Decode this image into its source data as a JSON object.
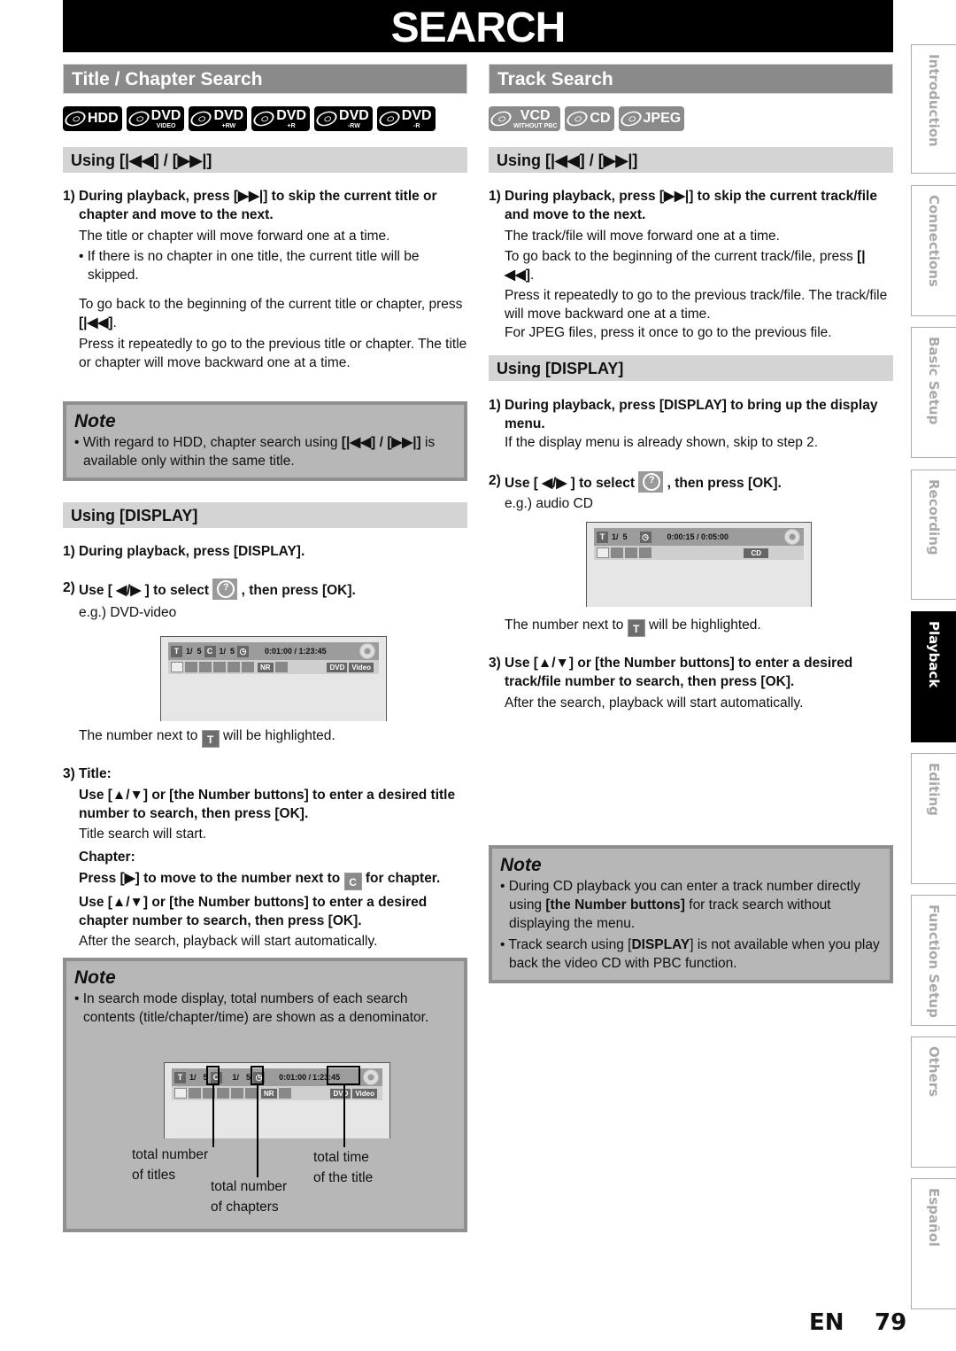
{
  "page": {
    "title": "SEARCH",
    "language": "EN",
    "page_number": "79"
  },
  "side_tabs": [
    {
      "label": "Introduction",
      "active": false
    },
    {
      "label": "Connections",
      "active": false
    },
    {
      "label": "Basic Setup",
      "active": false
    },
    {
      "label": "Recording",
      "active": false
    },
    {
      "label": "Playback",
      "active": true
    },
    {
      "label": "Editing",
      "active": false
    },
    {
      "label": "Function Setup",
      "active": false
    },
    {
      "label": "Others",
      "active": false
    },
    {
      "label": "Español",
      "active": false
    }
  ],
  "left": {
    "heading": "Title / Chapter Search",
    "media": [
      {
        "main": "HDD",
        "sub": ""
      },
      {
        "main": "DVD",
        "sub": "VIDEO"
      },
      {
        "main": "DVD",
        "sub": "+RW"
      },
      {
        "main": "DVD",
        "sub": "+R"
      },
      {
        "main": "DVD",
        "sub": "-RW"
      },
      {
        "main": "DVD",
        "sub": "-R"
      }
    ],
    "skip": {
      "heading": "Using [|◀◀] / [▶▶|]",
      "step1_num": "1)",
      "step1_bold": "During playback, press [▶▶|] to skip the current title or chapter and move to the next.",
      "step1_text": "The title or chapter will move forward one at a time.",
      "step1_bullet": "• If there is no chapter in one title, the current title will be skipped.",
      "back_text_a": "To go back to the beginning of the current title or chapter, press ",
      "back_key": "[|◀◀]",
      "back_text_b": ".",
      "repeat_text": "Press it repeatedly to go to the previous title or chapter. The title or chapter will move backward one at a time."
    },
    "note1": {
      "title": "Note",
      "item_a": "• With regard to HDD, chapter search using ",
      "item_key": "[|◀◀] / [▶▶|]",
      "item_b": " is available only within the same title."
    },
    "display": {
      "heading": "Using [DISPLAY]",
      "step1_num": "1)",
      "step1_bold": "During playback, press [DISPLAY].",
      "step2_num": "2)",
      "step2_bold_a": "Use [ ◀/▶ ] to select ",
      "step2_bold_b": " , then press [OK].",
      "example": "e.g.) DVD-video",
      "osd": {
        "title_icon": "T",
        "title_pos": "1/  5",
        "chapter_icon": "C",
        "chapter_pos": "1/  5",
        "time": "0:01:00 / 1:23:45",
        "tag1": "DVD",
        "tag2": "Video",
        "nr": "NR"
      },
      "highlight_a": "The number next to ",
      "highlight_icon": "T",
      "highlight_b": " will be highlighted.",
      "step3_num": "3)",
      "title_label": "Title:",
      "title_instr": "Use [▲/▼] or [the Number buttons] to enter a desired title number to search, then press [OK].",
      "title_result": "Title search will start.",
      "chapter_label": "Chapter:",
      "chapter_move_a": "Press [▶] to move to the number next to ",
      "chapter_icon": "C",
      "chapter_move_b": " for chapter.",
      "chapter_instr": "Use [▲/▼] or [the Number buttons] to enter a desired chapter number to search, then press [OK].",
      "after": "After the search, playback will start automatically."
    },
    "note2": {
      "title": "Note",
      "item": "• In search mode display, total numbers of each search contents (title/chapter/time) are shown as a denominator.",
      "osd": {
        "title_icon": "T",
        "title_cur": "1/",
        "title_total": "5",
        "chapter_icon": "C",
        "chapter_cur": "1/",
        "chapter_total": "5",
        "time_cur": "0:01:00 /",
        "time_total": "1:23:45",
        "tag1": "DVD",
        "tag2": "Video",
        "nr": "NR"
      },
      "callout_titles": "total number\nof titles",
      "callout_chapters": "total number\nof chapters",
      "callout_time": "total time\nof the title"
    }
  },
  "right": {
    "heading": "Track Search",
    "media": [
      {
        "main": "VCD",
        "sub": "WITHOUT PBC"
      },
      {
        "main": "CD",
        "sub": ""
      },
      {
        "main": "JPEG",
        "sub": ""
      }
    ],
    "skip": {
      "heading": "Using [|◀◀] / [▶▶|]",
      "step1_num": "1)",
      "step1_bold": "During playback, press [▶▶|] to skip the current track/file and move to the next.",
      "step1_text": "The track/file will move forward one at a time.",
      "back_text_a": "To go back to the beginning of the current track/file, press ",
      "back_key": "[|◀◀]",
      "back_text_b": ".",
      "repeat_text": "Press it repeatedly to go to the previous track/file. The track/file will move backward one at a time.",
      "jpeg_text": "For JPEG files, press it once to go to the previous file."
    },
    "display": {
      "heading": "Using [DISPLAY]",
      "step1_num": "1)",
      "step1_bold": "During playback, press [DISPLAY] to bring up the display menu.",
      "step1_text": "If the display menu is already shown, skip to step 2.",
      "step2_num": "2)",
      "step2_bold_a": "Use [ ◀/▶ ] to select ",
      "step2_bold_b": " , then press [OK].",
      "example": "e.g.) audio CD",
      "osd": {
        "title_icon": "T",
        "title_pos": "1/  5",
        "time": "0:00:15 / 0:05:00",
        "tag1": "CD"
      },
      "highlight_a": "The number next to ",
      "highlight_icon": "T",
      "highlight_b": " will be highlighted.",
      "step3_num": "3)",
      "step3_bold": "Use [▲/▼] or [the Number buttons] to enter a desired track/file number to search, then press [OK].",
      "step3_text": "After the search, playback will start automatically."
    },
    "note": {
      "title": "Note",
      "item1_a": "• During CD playback you can enter a track number directly using ",
      "item1_bold": "[the Number buttons]",
      "item1_b": " for track search without displaying the menu.",
      "item2_a": "• Track search using [",
      "item2_bold": "DISPLAY",
      "item2_b": "] is not available when you play back the video CD with PBC function."
    }
  }
}
